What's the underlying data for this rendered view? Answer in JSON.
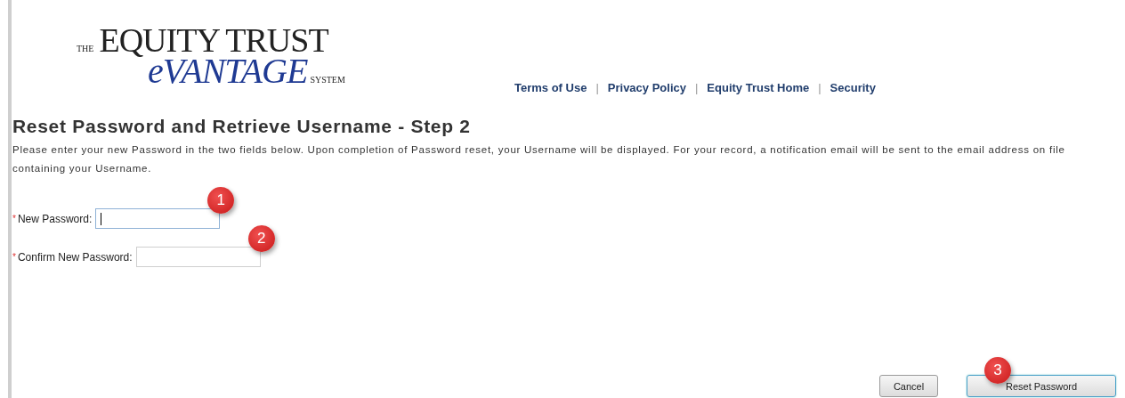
{
  "logo": {
    "prefix": "THE",
    "name": "EQUITY TRUST",
    "brand": "eVANTAGE",
    "suffix": "SYSTEM"
  },
  "nav": {
    "separator": "|",
    "links": [
      "Terms of Use",
      "Privacy Policy",
      "Equity Trust Home",
      "Security"
    ]
  },
  "heading": "Reset Password and Retrieve Username - Step 2",
  "intro": "Please enter your new Password in the two fields below. Upon completion of Password reset, your Username will be displayed. For your record, a notification email will be sent to the email address on file containing your Username.",
  "fields": [
    {
      "required_mark": "*",
      "label": "New Password:",
      "focused": true,
      "callout": "1"
    },
    {
      "required_mark": "*",
      "label": "Confirm New Password:",
      "focused": false,
      "callout": "2"
    }
  ],
  "buttons": [
    {
      "label": "Cancel",
      "primary": false
    },
    {
      "label": "Reset Password",
      "primary": true,
      "callout": "3"
    }
  ]
}
